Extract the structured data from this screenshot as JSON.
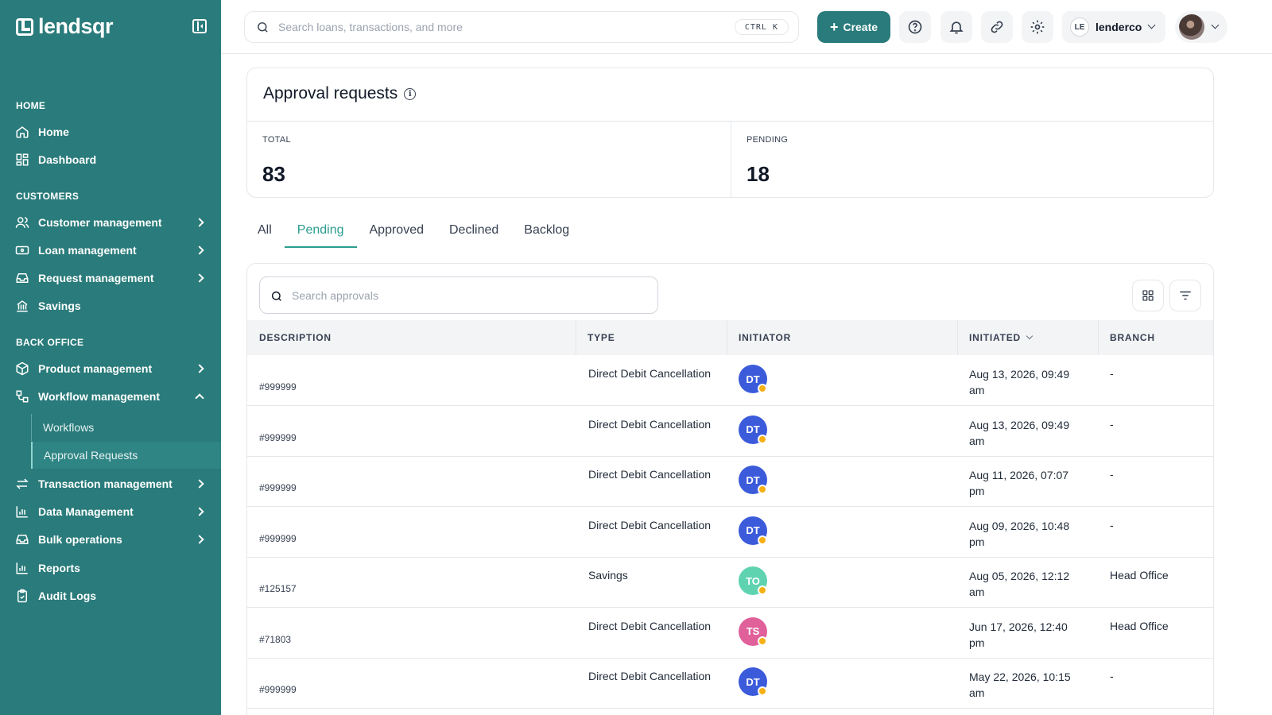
{
  "brand": {
    "name": "lendsqr"
  },
  "sidebar": {
    "sections": [
      {
        "title": "HOME"
      },
      {
        "title": "CUSTOMERS"
      },
      {
        "title": "BACK OFFICE"
      }
    ],
    "items": [
      {
        "label": "Home",
        "icon": "home-icon"
      },
      {
        "label": "Dashboard",
        "icon": "dashboard-icon"
      },
      {
        "label": "Customer management",
        "icon": "users-icon"
      },
      {
        "label": "Loan management",
        "icon": "loan-icon"
      },
      {
        "label": "Request management",
        "icon": "inbox-icon"
      },
      {
        "label": "Savings",
        "icon": "savings-icon"
      },
      {
        "label": "Product management",
        "icon": "box-icon"
      },
      {
        "label": "Workflow management",
        "icon": "workflow-icon"
      },
      {
        "label": "Transaction management",
        "icon": "transfer-icon"
      },
      {
        "label": "Data Management",
        "icon": "chart-icon"
      },
      {
        "label": "Bulk operations",
        "icon": "inbox-icon"
      },
      {
        "label": "Reports",
        "icon": "chart-icon"
      },
      {
        "label": "Audit Logs",
        "icon": "clipboard-icon"
      }
    ],
    "workflow_sub": [
      {
        "label": "Workflows"
      },
      {
        "label": "Approval Requests"
      }
    ]
  },
  "topbar": {
    "search_placeholder": "Search loans, transactions, and more",
    "shortcut": "CTRL K",
    "create_label": "Create",
    "org_initials": "LE",
    "org_name": "lenderco"
  },
  "page": {
    "title": "Approval requests",
    "stats": [
      {
        "label": "TOTAL",
        "value": "83"
      },
      {
        "label": "PENDING",
        "value": "18"
      }
    ],
    "tabs": [
      "All",
      "Pending",
      "Approved",
      "Declined",
      "Backlog"
    ],
    "active_tab": "Pending",
    "search_placeholder": "Search approvals",
    "columns": [
      "DESCRIPTION",
      "TYPE",
      "INITIATOR",
      "INITIATED",
      "BRANCH"
    ],
    "rows": [
      {
        "id": "#999999",
        "type": "Direct Debit Cancellation",
        "initials": "DT",
        "color": "#3b5bdb",
        "date1": "Aug 13, 2026, 09:49",
        "date2": "am",
        "branch": "-"
      },
      {
        "id": "#999999",
        "type": "Direct Debit Cancellation",
        "initials": "DT",
        "color": "#3b5bdb",
        "date1": "Aug 13, 2026, 09:49",
        "date2": "am",
        "branch": "-"
      },
      {
        "id": "#999999",
        "type": "Direct Debit Cancellation",
        "initials": "DT",
        "color": "#3b5bdb",
        "date1": "Aug 11, 2026, 07:07",
        "date2": "pm",
        "branch": "-"
      },
      {
        "id": "#999999",
        "type": "Direct Debit Cancellation",
        "initials": "DT",
        "color": "#3b5bdb",
        "date1": "Aug 09, 2026, 10:48",
        "date2": "pm",
        "branch": "-"
      },
      {
        "id": "#125157",
        "type": "Savings",
        "initials": "TO",
        "color": "#5fd3b0",
        "date1": "Aug 05, 2026, 12:12",
        "date2": "am",
        "branch": "Head Office"
      },
      {
        "id": "#71803",
        "type": "Direct Debit Cancellation",
        "initials": "TS",
        "color": "#e0609a",
        "date1": "Jun 17, 2026, 12:40",
        "date2": "pm",
        "branch": "Head Office"
      },
      {
        "id": "#999999",
        "type": "Direct Debit Cancellation",
        "initials": "DT",
        "color": "#3b5bdb",
        "date1": "May 22, 2026, 10:15",
        "date2": "am",
        "branch": "-"
      }
    ]
  }
}
